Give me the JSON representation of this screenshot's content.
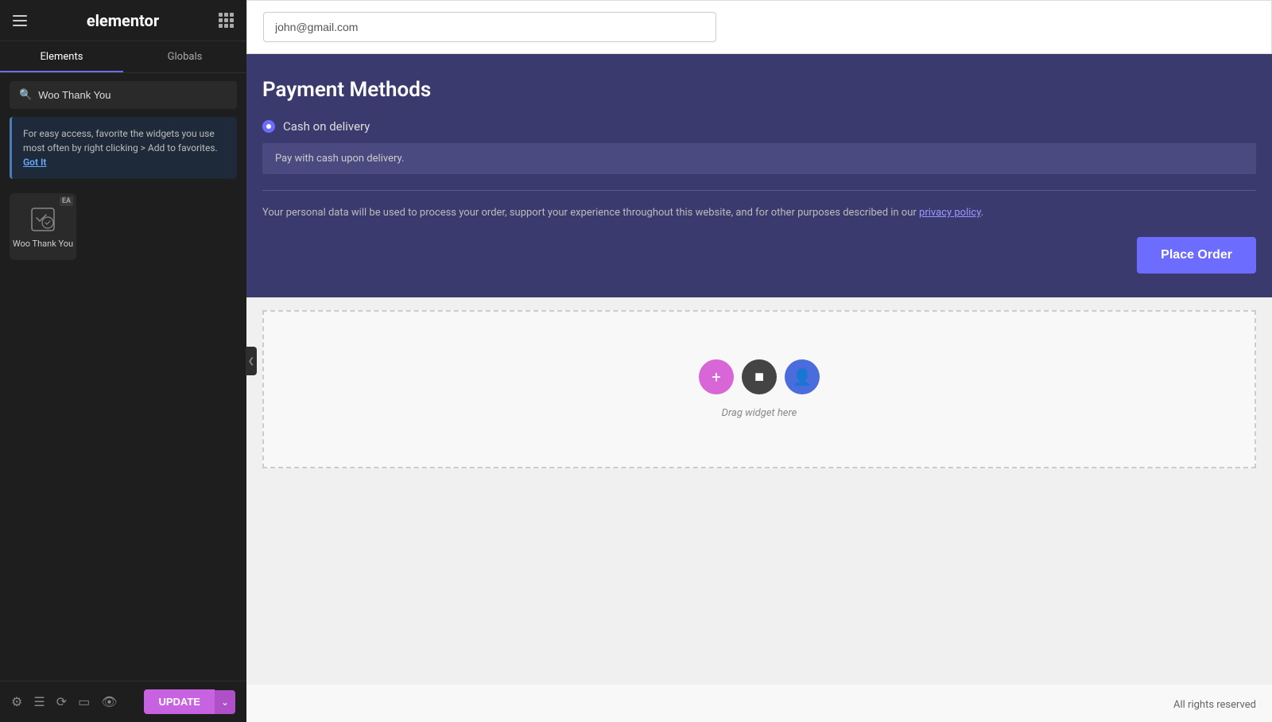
{
  "app": {
    "title": "elementor"
  },
  "sidebar": {
    "tabs": [
      {
        "label": "Elements",
        "active": true
      },
      {
        "label": "Globals",
        "active": false
      }
    ],
    "search": {
      "placeholder": "Woo Thank You",
      "value": "Woo Thank You"
    },
    "info_banner": {
      "text": "For easy access, favorite the widgets you use most often by right clicking > Add to favorites.",
      "link_text": "Got It"
    },
    "widget": {
      "label": "Woo Thank You",
      "badge": "EA"
    },
    "bottom_toolbar": {
      "icons": [
        "gear",
        "layers",
        "history",
        "responsive",
        "eye"
      ],
      "update_label": "UPDATE"
    }
  },
  "main": {
    "email_placeholder": "john@gmail.com",
    "payment": {
      "title": "Payment Methods",
      "option_label": "Cash on delivery",
      "description": "Pay with cash upon delivery.",
      "privacy_text": "Your personal data will be used to process your order, support your experience throughout this website, and for other purposes described in our ",
      "privacy_link": "privacy policy",
      "place_order_label": "Place Order"
    },
    "drop_zone": {
      "label": "Drag widget here"
    },
    "footer": {
      "text": "All rights reserved"
    }
  }
}
